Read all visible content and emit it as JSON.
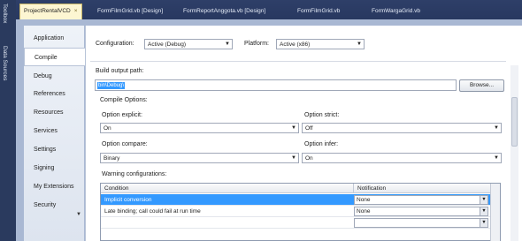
{
  "toolbox": {
    "toolbox_label": "Toolbox",
    "datasources_label": "Data Sources"
  },
  "tabs": [
    {
      "label": "ProjectRentalVCD",
      "close": "×"
    },
    {
      "label": "FormFilmGrid.vb [Design]"
    },
    {
      "label": "FormReportAnggota.vb [Design]"
    },
    {
      "label": "FormFilmGrid.vb"
    },
    {
      "label": "FormWargaGrid.vb"
    }
  ],
  "nav": {
    "items": [
      {
        "label": "Application"
      },
      {
        "label": "Compile"
      },
      {
        "label": "Debug"
      },
      {
        "label": "References"
      },
      {
        "label": "Resources"
      },
      {
        "label": "Services"
      },
      {
        "label": "Settings"
      },
      {
        "label": "Signing"
      },
      {
        "label": "My Extensions"
      },
      {
        "label": "Security"
      }
    ],
    "selected": "Compile"
  },
  "config": {
    "configuration_label": "Configuration:",
    "configuration_value": "Active (Debug)",
    "platform_label": "Platform:",
    "platform_value": "Active (x86)"
  },
  "build": {
    "output_label": "Build output path:",
    "output_value": "bin\\Debug\\",
    "browse_label": "Browse..."
  },
  "compile_options": {
    "group_label": "Compile Options:",
    "explicit_label": "Option explicit:",
    "explicit_value": "On",
    "strict_label": "Option strict:",
    "strict_value": "Off",
    "compare_label": "Option compare:",
    "compare_value": "Binary",
    "infer_label": "Option infer:",
    "infer_value": "On"
  },
  "warnings": {
    "group_label": "Warning configurations:",
    "columns": [
      "Condition",
      "Notification"
    ],
    "rows": [
      {
        "condition": "Implicit conversion",
        "notification": "None"
      },
      {
        "condition": "Late binding; call could fail at run time",
        "notification": "None"
      }
    ]
  },
  "icons": {
    "dropdown": "chevron-down-icon",
    "close": "close-icon"
  }
}
